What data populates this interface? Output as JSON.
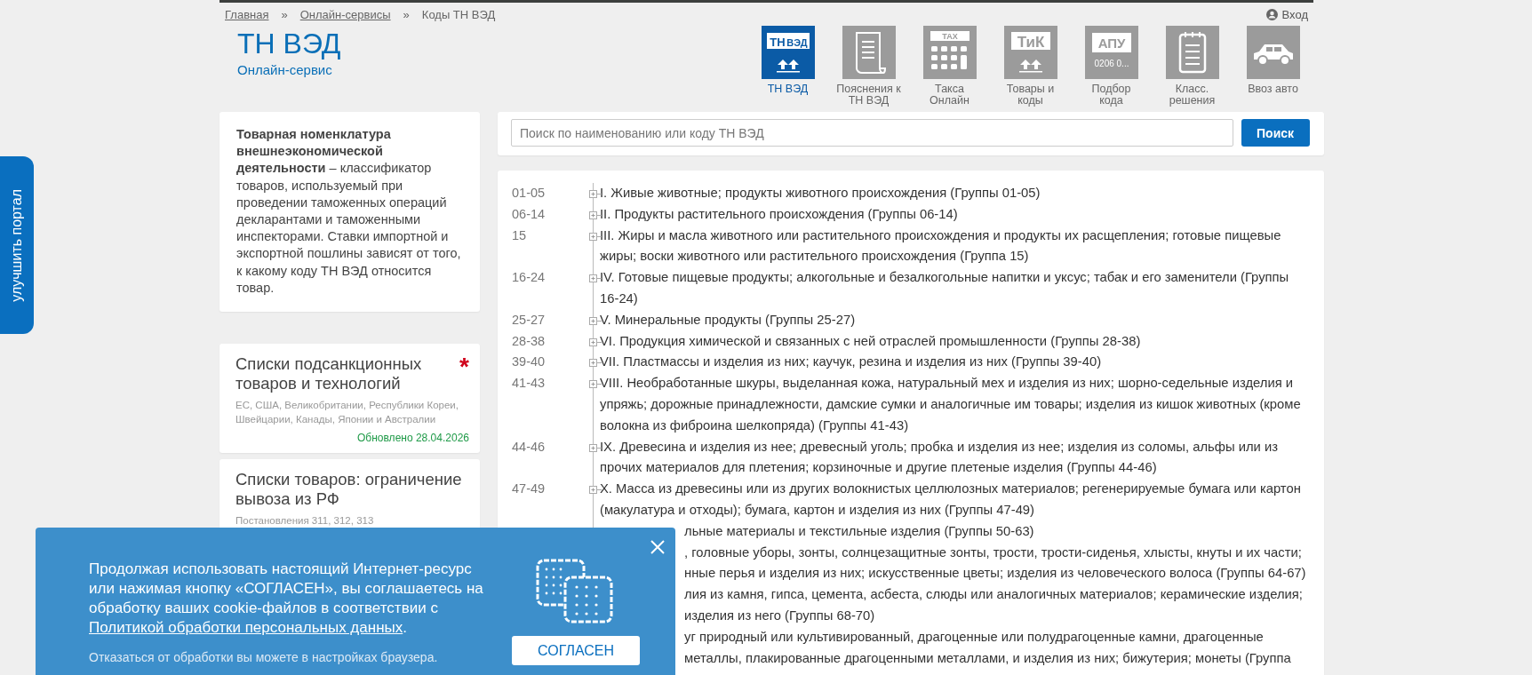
{
  "breadcrumb": [
    {
      "kind": "link",
      "text": "Главная"
    },
    {
      "kind": "separator",
      "text": "»"
    },
    {
      "kind": "link",
      "text": "Онлайн-сервисы"
    },
    {
      "kind": "separator",
      "text": "»"
    },
    {
      "kind": "current",
      "text": "Коды ТН ВЭД"
    }
  ],
  "login": {
    "label": "Вход"
  },
  "brand": {
    "title": "ТН ВЭД",
    "subtitle": "Онлайн-сервис"
  },
  "nav": [
    {
      "kind": "tnved",
      "icon_text": [
        "ТН",
        "ВЭД"
      ],
      "label": "ТН ВЭД",
      "selected": true
    },
    {
      "kind": "scroll",
      "label": "Пояснения к ТН ВЭД",
      "selected": false
    },
    {
      "kind": "tax",
      "icon_text": [
        "TAX"
      ],
      "label": "Такса Онлайн",
      "selected": false
    },
    {
      "kind": "tik",
      "icon_text": [
        "ТиК"
      ],
      "label": "Товары и коды",
      "selected": false
    },
    {
      "kind": "apu",
      "icon_text": [
        "АПУ",
        "0206 0..."
      ],
      "label": "Подбор кода",
      "selected": false
    },
    {
      "kind": "notepad",
      "label": "Класс. решения",
      "selected": false
    },
    {
      "kind": "car",
      "label": "Ввоз авто",
      "selected": false
    }
  ],
  "side_tab": {
    "label": "улучшить портал"
  },
  "intro": {
    "text": "**Товарная номенклатура внешнеэкономической деятельности** – классификатор товаров, используемый при проведении таможенных операций декларантами и таможенными инспекторами. Ставки импортной и экспортной пошлины зависят от того, к какому коду ТН ВЭД относится товар."
  },
  "promo_cards": [
    {
      "title": "Списки подсанкционных товаров и технологий",
      "badge": "*",
      "subtitle": "ЕС, США, Великобритании, Республики Кореи, Швейцарии, Канады, Японии и Австралии",
      "updated": "Обновлено 28.04.2026"
    },
    {
      "title": "Списки товаров: ограничение вывоза из РФ",
      "subtitle": "Постановления 311, 312, 313"
    }
  ],
  "search": {
    "placeholder": "Поиск по наименованию или коду ТН ВЭД",
    "button": "Поиск"
  },
  "sections": [
    {
      "kind": "section",
      "code": "01-05",
      "title": "I. Живые животные; продукты животного происхождения (Группы 01-05)",
      "expanded": false
    },
    {
      "kind": "section",
      "code": "06-14",
      "title": "II. Продукты растительного происхождения (Группы 06-14)",
      "expanded": false
    },
    {
      "kind": "section",
      "code": "15",
      "title": "III. Жиры и масла животного или растительного происхождения и продукты их расщепления; готовые пищевые жиры; воски животного или растительного происхождения (Группа 15)",
      "expanded": false
    },
    {
      "kind": "section",
      "code": "16-24",
      "title": "IV. Готовые пищевые продукты; алкогольные и безалкогольные напитки и уксус; табак и его заменители (Группы 16-24)",
      "expanded": false
    },
    {
      "kind": "section",
      "code": "25-27",
      "title": "V. Минеральные продукты (Группы 25-27)",
      "expanded": false
    },
    {
      "kind": "section",
      "code": "28-38",
      "title": "VI. Продукция химической и связанных с ней отраслей промышленности (Группы 28-38)",
      "expanded": false
    },
    {
      "kind": "section",
      "code": "39-40",
      "title": "VII. Пластмассы и изделия из них; каучук, резина и изделия из них (Группы 39-40)",
      "expanded": false
    },
    {
      "kind": "section",
      "code": "41-43",
      "title": "VIII. Необработанные шкуры, выделанная кожа, натуральный мех и изделия из них; шорно-седельные изделия и упряжь; дорожные принадлежности, дамские сумки и аналогичные им товары; изделия из кишок животных (кроме волокна из фиброина шелкопряда) (Группы 41-43)",
      "expanded": false
    },
    {
      "kind": "section",
      "code": "44-46",
      "title": "IX. Древесина и изделия из нее; древесный уголь; пробка и изделия из нее; изделия из соломы, альфы или из прочих материалов для плетения; корзиночные и другие плетеные изделия (Группы 44-46)",
      "expanded": false
    },
    {
      "kind": "section",
      "code": "47-49",
      "title": "X. Масса из древесины или из других волокнистых целлюлозных материалов; регенерируемые бумага или картон (макулатура и отходы); бумага, картон и изделия из них (Группы 47-49)",
      "expanded": false
    },
    {
      "kind": "fragment",
      "title": "льные материалы и текстильные изделия (Группы 50-63)"
    },
    {
      "kind": "fragment",
      "title": ", головные уборы, зонты, солнцезащитные зонты, трости, трости-сиденья, хлысты, кнуты и их части;"
    },
    {
      "kind": "fragment",
      "title": "нные перья и изделия из них; искусственные цветы; изделия из человеческого волоса (Группы 64-67)"
    },
    {
      "kind": "fragment",
      "title": "лия из камня, гипса, цемента, асбеста, слюды или аналогичных материалов; керамические изделия;"
    },
    {
      "kind": "fragment",
      "title": "изделия из него (Группы 68-70)"
    },
    {
      "kind": "fragment",
      "title": "уг природный или культивированный, драгоценные или полудрагоценные камни, драгоценные"
    },
    {
      "kind": "fragment",
      "title": "металлы, плакированные драгоценными металлами, и изделия из них; бижутерия; монеты (Группа"
    }
  ],
  "cookie_banner": {
    "text": "Продолжая использовать настоящий Интернет-ресурс или нажимая кнопку «СОГЛАСЕН», вы соглашаетесь на обработку ваших cookie-файлов в соответствии с",
    "link": "Политикой обработки персональных данных",
    "text_end": ".",
    "note": "Отказаться от обработки вы можете в настройках браузера.",
    "button": "СОГЛАСЕН"
  }
}
